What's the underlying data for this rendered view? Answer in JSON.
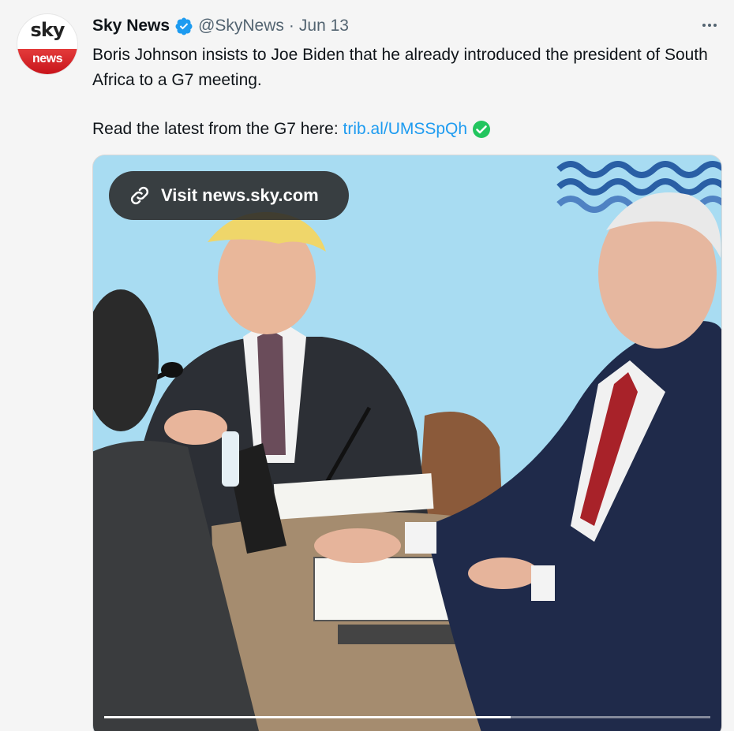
{
  "tweet": {
    "avatar": {
      "top": "sky",
      "bottom": "news"
    },
    "display_name": "Sky News",
    "handle": "@SkyNews",
    "separator": "·",
    "date": "Jun 13",
    "text_line1": "Boris Johnson insists to Joe Biden that he already introduced the president of South Africa to a G7 meeting.",
    "text_line2_prefix": "Read the latest from the G7 here: ",
    "link": "trib.al/UMSSpQh",
    "icons": [
      "verified-badge-icon",
      "check-mark-emoji-icon",
      "more-options-icon",
      "link-icon"
    ]
  },
  "media": {
    "visit_label": "Visit news.sky.com",
    "progress_fraction": 0.67
  },
  "colors": {
    "accent": "#1d9bf0",
    "verified": "#1d9bf0",
    "emoji_check": "#22c55e",
    "brand_red": "#c8141b"
  }
}
